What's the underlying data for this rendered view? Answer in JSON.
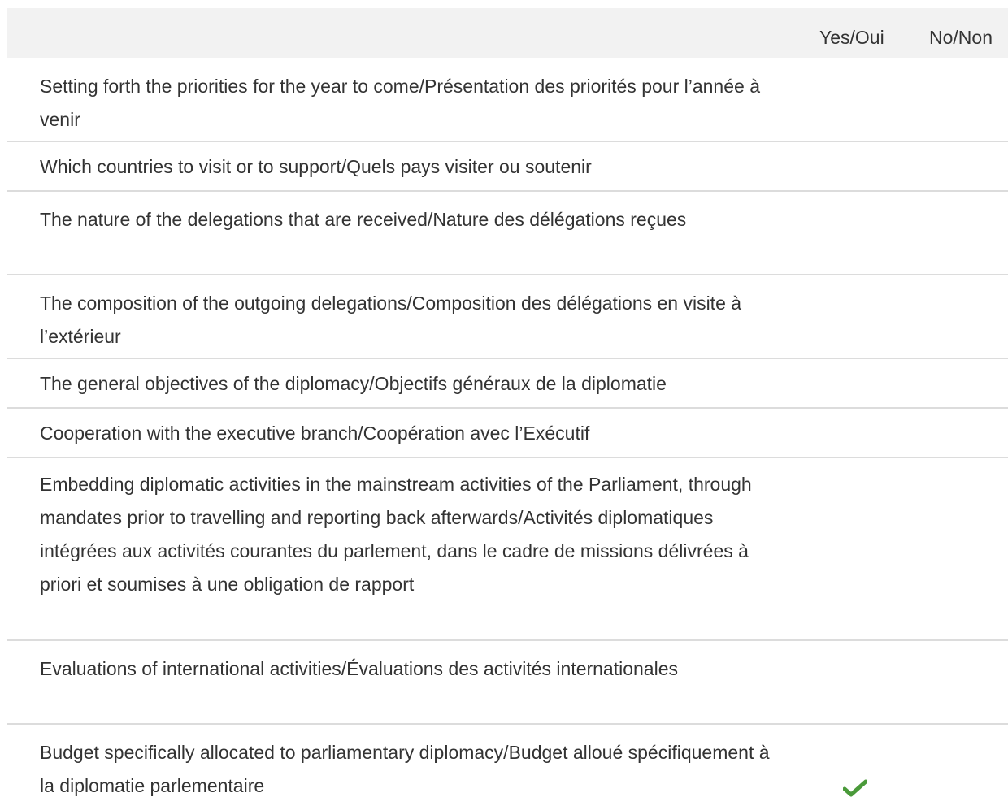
{
  "table": {
    "header": {
      "yes_label": "Yes/Oui",
      "no_label": "No/Non"
    },
    "rows": [
      {
        "label": "Setting forth the priorities for the year to come/Présentation des priorités pour l’année à venir",
        "answer": ""
      },
      {
        "label": "Which countries to visit or to support/Quels pays visiter ou soutenir",
        "answer": ""
      },
      {
        "label": "The nature of the delegations that are received/Nature des délégations reçues",
        "answer": ""
      },
      {
        "label": "The composition of the outgoing delegations/Composition des délégations en visite à l’extérieur",
        "answer": ""
      },
      {
        "label": "The general objectives of the diplomacy/Objectifs généraux de la diplomatie",
        "answer": ""
      },
      {
        "label": "Cooperation with the executive branch/Coopération avec l’Exécutif",
        "answer": ""
      },
      {
        "label": "Embedding diplomatic activities in the mainstream activities of the Parliament, through mandates prior to travelling and reporting back afterwards/Activités diplomatiques intégrées aux activités courantes du parlement, dans le cadre de missions délivrées à priori et soumises à une obligation de rapport",
        "answer": ""
      },
      {
        "label": "Evaluations of international activities/Évaluations des activités internationales",
        "answer": ""
      },
      {
        "label": "Budget specifically allocated to parliamentary diplomacy/Budget alloué spécifiquement à la diplomatie parlementaire",
        "answer": "yes"
      }
    ],
    "colors": {
      "checkmark": "#4a9a3a",
      "header_bg": "#f2f2f2",
      "divider": "#dcdcdc",
      "text": "#333333"
    },
    "icons": {
      "checkmark": "checkmark-icon"
    }
  }
}
